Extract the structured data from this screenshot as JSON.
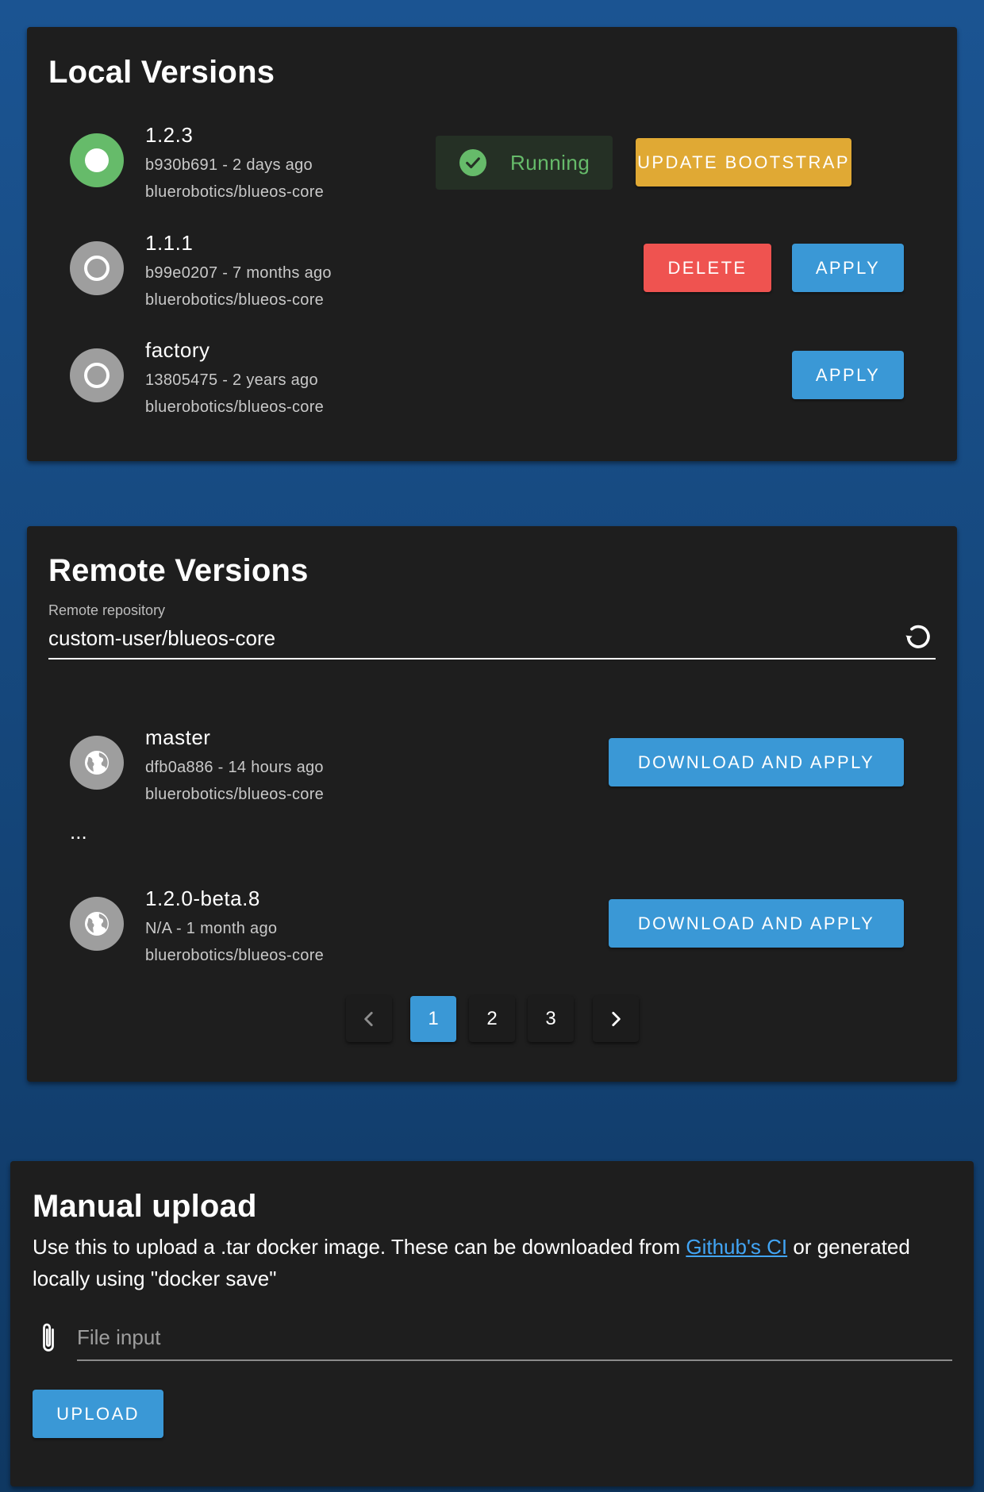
{
  "local": {
    "title": "Local Versions",
    "running_label": "Running",
    "versions": [
      {
        "name": "1.2.3",
        "sub": "b930b691 - 2 days ago",
        "repo": "bluerobotics/blueos-core",
        "status": "current",
        "primary_button": "UPDATE BOOTSTRAP"
      },
      {
        "name": "1.1.1",
        "sub": "b99e0207 - 7 months ago",
        "repo": "bluerobotics/blueos-core",
        "status": "inactive",
        "delete_button": "DELETE",
        "apply_button": "APPLY"
      },
      {
        "name": "factory",
        "sub": "13805475 - 2 years ago",
        "repo": "bluerobotics/blueos-core",
        "status": "inactive",
        "apply_button": "APPLY"
      }
    ]
  },
  "remote": {
    "title": "Remote Versions",
    "repo_field": {
      "label": "Remote repository",
      "value": "custom-user/blueos-core"
    },
    "ellipsis": "...",
    "versions": [
      {
        "name": "master",
        "sub": "dfb0a886 - 14 hours ago",
        "repo": "bluerobotics/blueos-core",
        "button": "DOWNLOAD AND APPLY"
      },
      {
        "name": "1.2.0-beta.8",
        "sub": "N/A - 1 month ago",
        "repo": "bluerobotics/blueos-core",
        "button": "DOWNLOAD AND APPLY"
      }
    ],
    "pagination": {
      "pages": [
        "1",
        "2",
        "3"
      ],
      "current": "1"
    }
  },
  "manual": {
    "title": "Manual upload",
    "desc_before": "Use this to upload a .tar docker image. These can be downloaded from ",
    "desc_link": "Github's CI",
    "desc_after": " or generated locally using \"docker save\"",
    "file_placeholder": "File input",
    "upload_button": "UPLOAD"
  },
  "colors": {
    "background_top": "#1b5492",
    "background_bottom": "#0f3862",
    "card": "#1e1e1e",
    "running_green": "#66bb6a",
    "button_blue": "#3a98d6",
    "button_yellow": "#e0a934",
    "button_red": "#ef5350",
    "inactive_grey": "#9e9e9e",
    "link_blue": "#42a5f5"
  },
  "icons": {
    "current_version": "radio-checked-icon",
    "inactive_version": "radio-unchecked-icon",
    "remote_version": "globe-icon",
    "running": "check-circle-icon",
    "refresh": "refresh-icon",
    "prev_page": "chevron-left-icon",
    "next_page": "chevron-right-icon",
    "file": "paperclip-icon"
  }
}
